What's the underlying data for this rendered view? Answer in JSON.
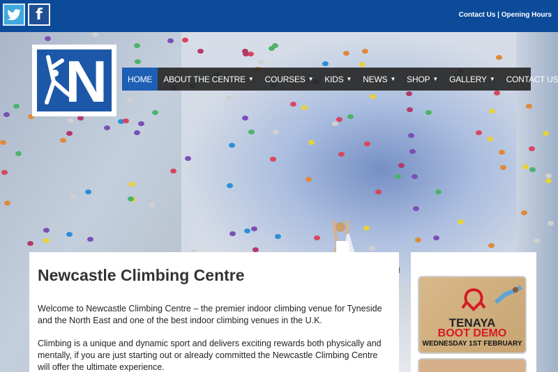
{
  "topbar": {
    "social": [
      {
        "name": "twitter",
        "glyph": "🐦"
      },
      {
        "name": "facebook",
        "glyph": "f"
      }
    ],
    "links": [
      "Contact Us",
      "Opening Hours"
    ],
    "separator": " | "
  },
  "nav": {
    "items": [
      {
        "label": "HOME",
        "active": true,
        "dropdown": false
      },
      {
        "label": "ABOUT THE CENTRE",
        "dropdown": true
      },
      {
        "label": "COURSES",
        "dropdown": true
      },
      {
        "label": "KIDS",
        "dropdown": true
      },
      {
        "label": "NEWS",
        "dropdown": true
      },
      {
        "label": "SHOP",
        "dropdown": true
      },
      {
        "label": "GALLERY",
        "dropdown": true
      },
      {
        "label": "CONTACT US",
        "dropdown": true
      }
    ]
  },
  "main": {
    "title": "Newcastle Climbing Centre",
    "paragraphs": [
      "Welcome to Newcastle Climbing Centre – the premier indoor climbing venue for Tyneside and the North East and one of the best indoor climbing venues in the U.K.",
      "Climbing is a unique and dynamic sport and delivers exciting rewards both physically and mentally, if you are just starting out or already committed the Newcastle Climbing Centre will offer the ultimate experience."
    ]
  },
  "sidebar": {
    "promo": {
      "brand": "TENAYA",
      "title": "BOOT DEMO",
      "date": "WEDNESDAY 1ST FEBRUARY"
    }
  },
  "colors": {
    "topbar": "#0c4a9a",
    "nav_active": "#1d5fb4",
    "promo_title": "#d41c24"
  }
}
